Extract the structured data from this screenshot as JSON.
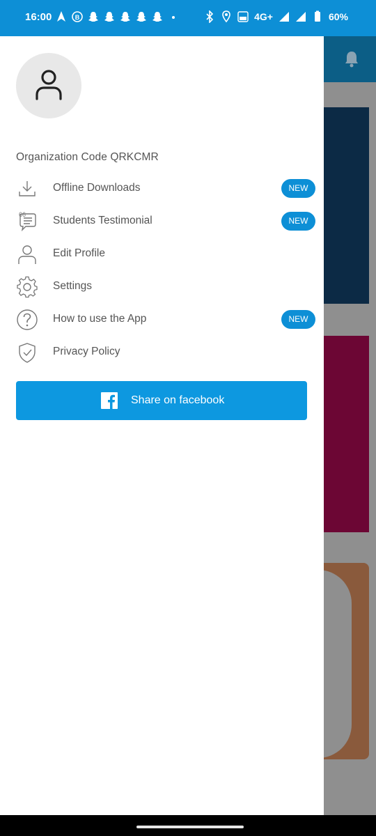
{
  "status_bar": {
    "time": "16:00",
    "network": "4G+",
    "battery": "60%"
  },
  "drawer": {
    "organization_label": "Organization Code QRKCMR",
    "menu": [
      {
        "label": "Offline Downloads",
        "icon": "download-icon",
        "badge": "NEW"
      },
      {
        "label": "Students Testimonial",
        "icon": "testimonial-icon",
        "badge": "NEW"
      },
      {
        "label": "Edit Profile",
        "icon": "user-icon",
        "badge": ""
      },
      {
        "label": "Settings",
        "icon": "gear-icon",
        "badge": ""
      },
      {
        "label": "How to use the App",
        "icon": "help-icon",
        "badge": "NEW"
      },
      {
        "label": "Privacy Policy",
        "icon": "shield-icon",
        "badge": ""
      }
    ],
    "share_button_label": "Share on facebook"
  },
  "colors": {
    "accent": "#0d8fd6",
    "button": "#0d98e0"
  }
}
